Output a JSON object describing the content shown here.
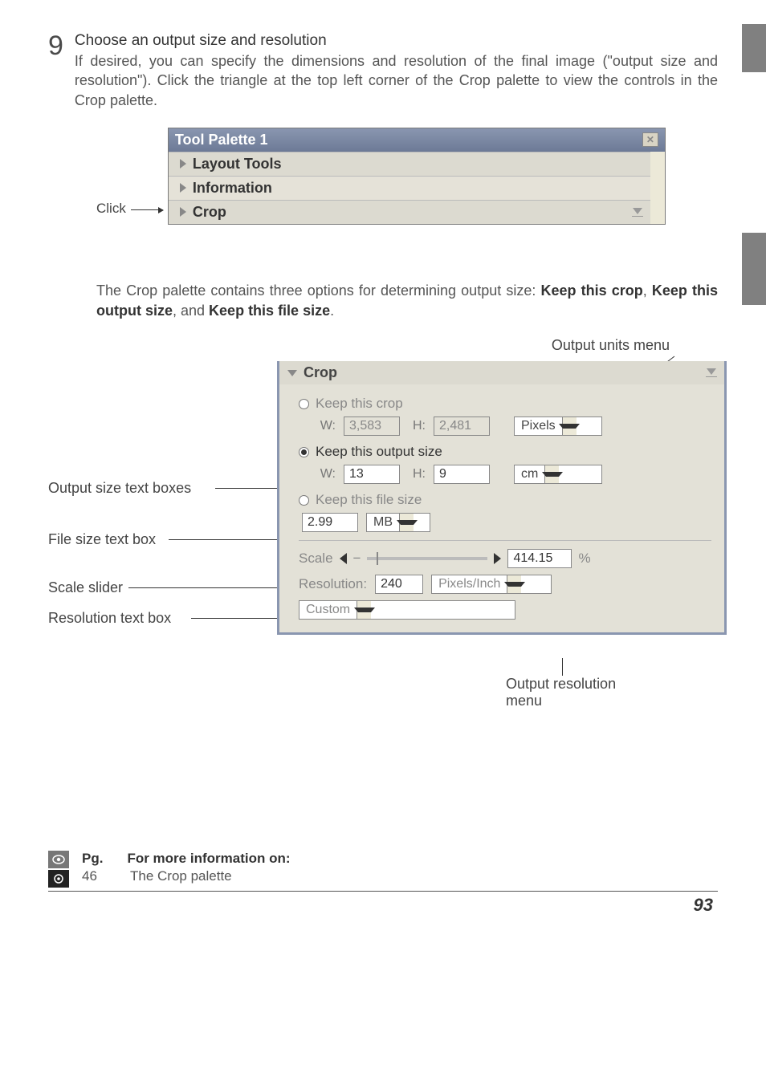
{
  "step": {
    "number": "9",
    "title": "Choose an output size and resolution",
    "body": "If desired, you can specify the dimensions and resolution of the final image (\"output size and resolution\").  Click the triangle at the top left corner of the Crop palette to view the controls in the Crop palette."
  },
  "fig1": {
    "click_label": "Click",
    "window_title": "Tool Palette 1",
    "section_layout": "Layout Tools",
    "section_info": "Information",
    "section_crop": "Crop"
  },
  "mid_paragraph_pre": "The Crop palette contains three options for determining output size: ",
  "mid_paragraph_b1": "Keep this crop",
  "mid_paragraph_mid1": ", ",
  "mid_paragraph_b2": "Keep this output size",
  "mid_paragraph_mid2": ", and ",
  "mid_paragraph_b3": "Keep this file size",
  "mid_paragraph_post": ".",
  "anno": {
    "output_units": "Output units menu",
    "output_size_boxes": "Output size text boxes",
    "file_size_box": "File size text box",
    "scale_slider": "Scale slider",
    "resolution_box": "Resolution text box",
    "output_res_menu": "Output resolution\nmenu"
  },
  "crop": {
    "header": "Crop",
    "opt_keep_crop": "Keep this crop",
    "w_label": "W:",
    "h_label": "H:",
    "crop_w": "3,583",
    "crop_h": "2,481",
    "units_px": "Pixels",
    "opt_keep_output": "Keep this output size",
    "out_w": "13",
    "out_h": "9",
    "units_cm": "cm",
    "opt_keep_file": "Keep this file size",
    "file_size": "2.99",
    "file_units": "MB",
    "scale_label": "Scale",
    "scale_value": "414.15",
    "scale_pct": "%",
    "resolution_label": "Resolution:",
    "resolution_value": "240",
    "resolution_units": "Pixels/Inch",
    "preset": "Custom"
  },
  "footer": {
    "col_pg": "Pg.",
    "col_info": "For more information on:",
    "row_pg": "46",
    "row_info": "The Crop palette",
    "page_number": "93"
  }
}
